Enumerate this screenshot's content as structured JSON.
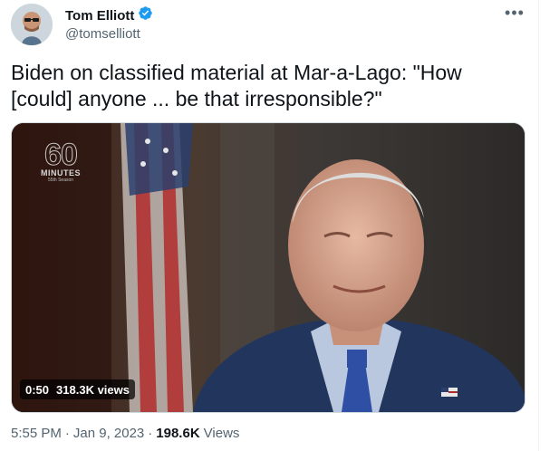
{
  "author": {
    "name": "Tom Elliott",
    "handle": "@tomselliott",
    "verified": true
  },
  "tweet": {
    "text": "Biden on classified material at Mar-a-Lago: \"How\n[could] anyone ... be that irresponsible?\""
  },
  "video": {
    "overlay_logo": {
      "number": "60",
      "word": "MINUTES",
      "season": "55th Season"
    },
    "duration": "0:50",
    "views_label": "318.3K views"
  },
  "meta": {
    "time": "5:55 PM",
    "separator": "·",
    "date": "Jan 9, 2023",
    "views_count": "198.6K",
    "views_word": "Views"
  },
  "menu": {
    "more_label": "•••"
  },
  "colors": {
    "verified_badge": "#1d9bf0",
    "secondary_text": "#536471",
    "primary_text": "#0f1419"
  },
  "icons": {
    "verified": "verified-badge-icon",
    "more": "more-options-icon"
  }
}
